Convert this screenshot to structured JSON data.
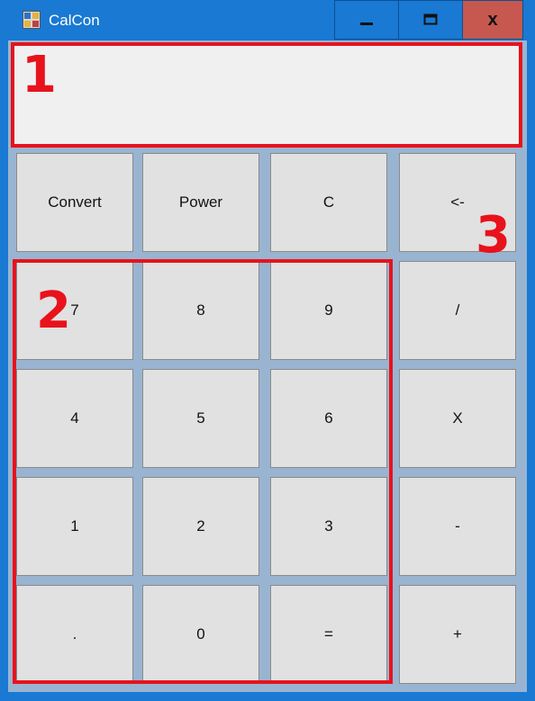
{
  "window": {
    "title": "CalCon",
    "minimize_glyph": "–",
    "close_glyph": "x"
  },
  "display": {
    "value": ""
  },
  "buttons": {
    "convert": "Convert",
    "power": "Power",
    "clear": "C",
    "backspace": "<-",
    "seven": "7",
    "eight": "8",
    "nine": "9",
    "divide": "/",
    "four": "4",
    "five": "5",
    "six": "6",
    "multiply": "X",
    "one": "1",
    "two": "2",
    "three": "3",
    "subtract": "-",
    "decimal": ".",
    "zero": "0",
    "equals": "=",
    "add": "+"
  },
  "annotations": {
    "label_1": "1",
    "label_2": "2",
    "label_3": "3"
  },
  "colors": {
    "titlebar": "#1979d3",
    "client": "#99b4d1",
    "annotation": "#e8121c",
    "close": "#c7584f"
  }
}
